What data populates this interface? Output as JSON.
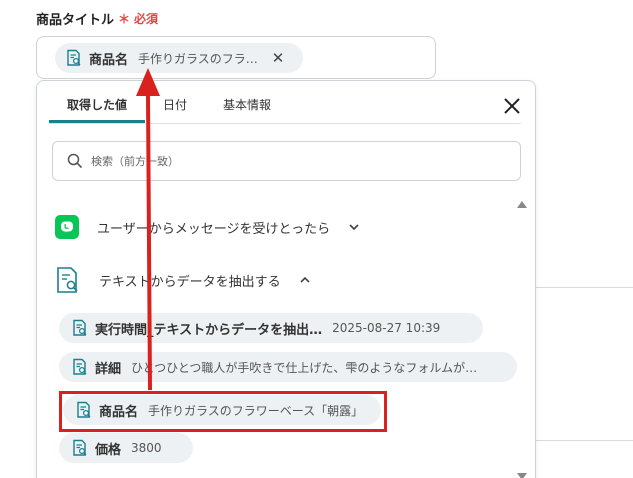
{
  "field": {
    "label": "商品タイトル",
    "required_mark": "＊",
    "required_text": "必須",
    "chip_label": "商品名",
    "chip_value": "手作りガラスのフラ…",
    "remove_glyph": "✕"
  },
  "panel": {
    "tabs": [
      "取得した値",
      "日付",
      "基本情報"
    ],
    "active_tab": "取得した値",
    "search_placeholder": "検索（前方一致）",
    "sections": [
      {
        "title": "ユーザーからメッセージを受けとったら",
        "expanded": false,
        "icon": "line-app-icon"
      },
      {
        "title": "テキストからデータを抽出する",
        "expanded": true,
        "icon": "document-search-icon"
      }
    ],
    "items": [
      {
        "label": "実行時間_テキストからデータを抽出…",
        "value": "2025-08-27 10:39"
      },
      {
        "label": "詳細",
        "value": "ひとつひとつ職人が手吹きで仕上げた、雫のようなフォルムが…"
      },
      {
        "label": "商品名",
        "value": "手作りガラスのフラワーベース「朝露」"
      },
      {
        "label": "価格",
        "value": "3800"
      }
    ]
  },
  "colors": {
    "accent": "#1b7f8e",
    "required": "#e64545",
    "annotation": "#d9211d",
    "line_green": "#06c755"
  }
}
